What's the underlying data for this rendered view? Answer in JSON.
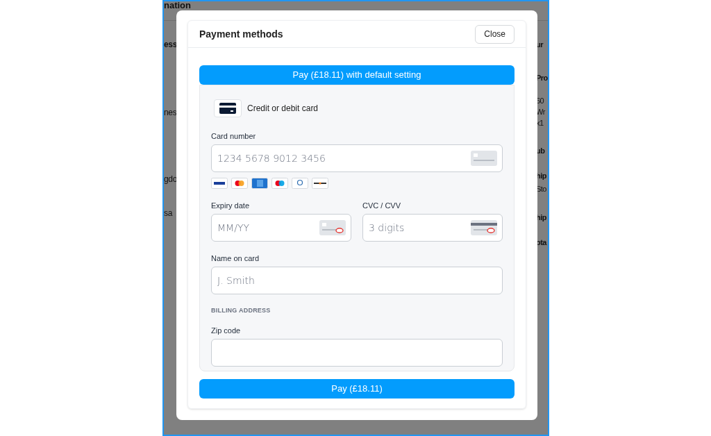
{
  "background_page": {
    "heading": "nation",
    "left_fragments": [
      {
        "text": "ess",
        "bold": true
      },
      {
        "text": "nes",
        "bold": false
      },
      {
        "text": "gdo",
        "bold": false
      },
      {
        "text": "sa",
        "bold": false
      }
    ],
    "right_fragments": [
      {
        "text": "ur",
        "bold": true
      },
      {
        "text": "Pro",
        "bold": true
      },
      {
        "text": "60",
        "bold": false
      },
      {
        "text": "Wr",
        "bold": false
      },
      {
        "text": "x1",
        "bold": false
      },
      {
        "text": "ub",
        "bold": true
      },
      {
        "text": "hip",
        "bold": true
      },
      {
        "text": "Sto",
        "bold": false
      },
      {
        "text": "hip",
        "bold": true
      },
      {
        "text": "ota",
        "bold": true
      }
    ]
  },
  "modal": {
    "title": "Payment methods",
    "close_button": "Close",
    "pay_default_button": "Pay (£18.11) with default setting",
    "payment_method": {
      "label": "Credit or debit card"
    },
    "card_number": {
      "label": "Card number",
      "placeholder": "1234 5678 9012 3456"
    },
    "expiry": {
      "label": "Expiry date",
      "placeholder": "MM/YY"
    },
    "cvc": {
      "label": "CVC / CVV",
      "placeholder": "3 digits"
    },
    "name_on_card": {
      "label": "Name on card",
      "placeholder": "J. Smith"
    },
    "billing_heading": "BILLING ADDRESS",
    "zip": {
      "label": "Zip code"
    },
    "pay_button": "Pay (£18.11)"
  }
}
